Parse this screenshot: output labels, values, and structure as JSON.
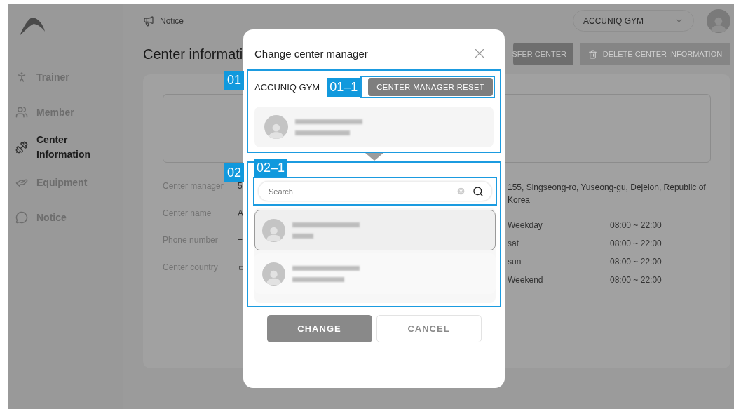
{
  "sidebar": {
    "items": [
      {
        "label": "Trainer",
        "kind": "trainer",
        "selected": false
      },
      {
        "label": "Member",
        "kind": "member",
        "selected": false
      },
      {
        "label": "Center\nInformation",
        "kind": "center",
        "selected": true
      },
      {
        "label": "Equipment",
        "kind": "equipment",
        "selected": false
      },
      {
        "label": "Notice",
        "kind": "notice",
        "selected": false
      }
    ]
  },
  "topbar": {
    "notice_link": "Notice",
    "center_select": {
      "value": "ACCUNIQ GYM"
    }
  },
  "page": {
    "title": "Center informati",
    "buttons": [
      {
        "label": "SFER CENTER",
        "kind": "transfer"
      },
      {
        "label": "DELETE CENTER INFORMATION",
        "kind": "delete"
      }
    ],
    "info_rows": [
      {
        "label": "Center manager",
        "value": "5"
      },
      {
        "label": "Center name",
        "value": "A"
      },
      {
        "label": "Phone number",
        "value": "+"
      },
      {
        "label": "Center country",
        "value": "ㄷ"
      }
    ],
    "address": "155, Singseong-ro, Yuseong-gu, Dejeion, Republic of Korea",
    "hours": [
      {
        "day": "Weekday",
        "time": "08:00 ~ 22:00"
      },
      {
        "day": "sat",
        "time": "08:00 ~ 22:00"
      },
      {
        "day": "sun",
        "time": "08:00 ~ 22:00"
      },
      {
        "day": "Weekend",
        "time": "08:00 ~ 22:00"
      }
    ]
  },
  "dialog": {
    "title": "Change center manager",
    "center_name": "ACCUNIQ GYM",
    "reset_button": "CENTER MANAGER RESET",
    "search": {
      "placeholder": "Search"
    },
    "members": [
      {
        "selected": true
      },
      {
        "selected": false
      }
    ],
    "buttons": [
      {
        "label": "CHANGE",
        "kind": "primary"
      },
      {
        "label": "CANCEL",
        "kind": "secondary"
      }
    ]
  },
  "annotations": [
    {
      "label": "01"
    },
    {
      "label": "01–1"
    },
    {
      "label": "02"
    },
    {
      "label": "02–1"
    }
  ]
}
